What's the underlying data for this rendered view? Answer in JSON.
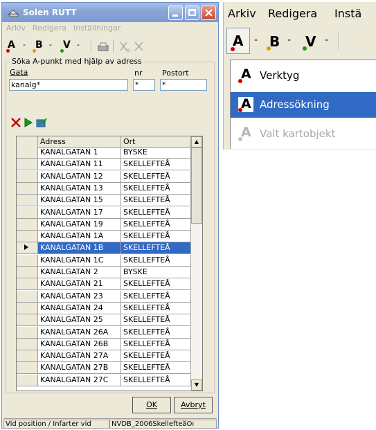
{
  "window": {
    "title": "Solen RUTT",
    "menu": [
      "Arkiv",
      "Redigera",
      "Inställningar"
    ]
  },
  "toolbar": {
    "a_letter": "A",
    "b_letter": "B",
    "v_letter": "V"
  },
  "search_group": {
    "title": "Söka A-punkt med hjälp av adress",
    "gata_label": "Gata",
    "nr_label": "nr",
    "postort_label": "Postort",
    "gata_value": "kanalg*",
    "nr_value": "*",
    "postort_value": "*"
  },
  "grid": {
    "columns": [
      "Adress",
      "Ort"
    ],
    "rows": [
      [
        "KANALGATAN 1",
        "BYSKE"
      ],
      [
        "KANALGATAN 11",
        "SKELLEFTEÅ"
      ],
      [
        "KANALGATAN 12",
        "SKELLEFTEÅ"
      ],
      [
        "KANALGATAN 13",
        "SKELLEFTEÅ"
      ],
      [
        "KANALGATAN 15",
        "SKELLEFTEÅ"
      ],
      [
        "KANALGATAN 17",
        "SKELLEFTEÅ"
      ],
      [
        "KANALGATAN 19",
        "SKELLEFTEÅ"
      ],
      [
        "KANALGATAN 1A",
        "SKELLEFTEÅ"
      ],
      [
        "KANALGATAN 1B",
        "SKELLEFTEÅ"
      ],
      [
        "KANALGATAN 1C",
        "SKELLEFTEÅ"
      ],
      [
        "KANALGATAN 2",
        "BYSKE"
      ],
      [
        "KANALGATAN 21",
        "SKELLEFTEÅ"
      ],
      [
        "KANALGATAN 23",
        "SKELLEFTEÅ"
      ],
      [
        "KANALGATAN 24",
        "SKELLEFTEÅ"
      ],
      [
        "KANALGATAN 25",
        "SKELLEFTEÅ"
      ],
      [
        "KANALGATAN 26A",
        "SKELLEFTEÅ"
      ],
      [
        "KANALGATAN 26B",
        "SKELLEFTEÅ"
      ],
      [
        "KANALGATAN 27A",
        "SKELLEFTEÅ"
      ],
      [
        "KANALGATAN 27B",
        "SKELLEFTEÅ"
      ],
      [
        "KANALGATAN 27C",
        "SKELLEFTEÅ"
      ]
    ],
    "selected_index": 8
  },
  "buttons": {
    "ok": "OK",
    "cancel": "Avbryt"
  },
  "statusbar": {
    "left": "Vid position / Infarter vid",
    "right": "NVDB_2006SkellefteåOı"
  },
  "right_panel": {
    "menu": [
      "Arkiv",
      "Redigera",
      "Instä"
    ],
    "toolbar": {
      "a_letter": "A",
      "b_letter": "B",
      "v_letter": "V"
    },
    "dropdown": [
      {
        "label": "Verktyg",
        "state": "normal"
      },
      {
        "label": "Adressökning",
        "state": "highlighted"
      },
      {
        "label": "Valt kartobjekt",
        "state": "disabled"
      }
    ]
  },
  "colors": {
    "selection": "#316ac5",
    "face": "#ece9d8",
    "a_red": "#cc0000",
    "b_orange": "#d9a000",
    "v_green": "#1a9a1a"
  }
}
